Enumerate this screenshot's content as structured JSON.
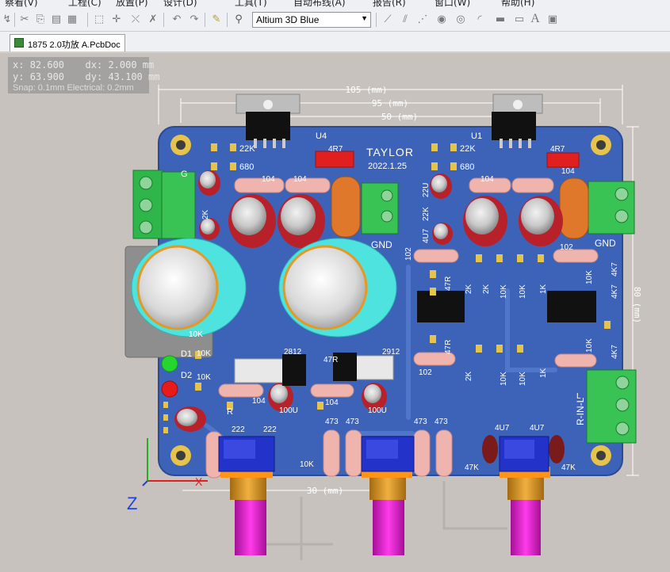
{
  "menu": {
    "items": [
      "察看(V)",
      "工程(C)",
      "放置(P)",
      "设计(D)",
      "工具(T)",
      "自动布线(A)",
      "报告(R)",
      "窗口(W)",
      "帮助(H)"
    ]
  },
  "toolbar": {
    "view_config": "Altium 3D Blue",
    "icons": [
      "cut-icon",
      "copy-icon",
      "paste-icon",
      "stamp-icon",
      "select-rect-icon",
      "move-icon",
      "deselect-icon",
      "clear-icon",
      "undo-icon",
      "redo-icon",
      "highlight-icon",
      "browse-icon",
      "route-icon",
      "net-icon",
      "bus-icon",
      "pad-icon",
      "via-icon",
      "arc-icon",
      "fill-icon",
      "text-icon",
      "component-icon"
    ]
  },
  "tabs": {
    "active_doc": "1875 2.0功放 A.PcbDoc"
  },
  "coords": {
    "x_label": "x:",
    "x": "82.600",
    "dx_label": "dx:",
    "dx": "2.000",
    "y_label": "y:",
    "y": "63.900",
    "dy_label": "dy:",
    "dy": "43.100",
    "unit": "mm",
    "snap": "Snap: 0.1mm Electrical: 0.2mm"
  },
  "pcb": {
    "dimensions": {
      "outer": "105 (mm)",
      "middle": "95 (mm)",
      "inner": "50 (mm)",
      "right": "80 (mm)",
      "bottom": "30 (mm)"
    },
    "silkscreen": {
      "brand": "TAYLOR",
      "date": "2022.1.25",
      "u4": "U4",
      "u1": "U1",
      "gnd_left": "GND",
      "gnd_right": "GND",
      "input": "R-IN-L",
      "d1": "D1",
      "d2": "D2",
      "z_axis": "Z"
    },
    "labels": [
      "22K",
      "680",
      "4R7",
      "104",
      "104",
      "22U",
      "22K",
      "4U7",
      "102",
      "47R",
      "2K",
      "2K",
      "10K",
      "10K",
      "1K",
      "10K",
      "4K7",
      "22K",
      "680",
      "4R7",
      "104",
      "104",
      "102",
      "4K7",
      "47R",
      "10K",
      "1K",
      "10K",
      "10K",
      "2K",
      "102",
      "4K7",
      "47R",
      "2812",
      "2912",
      "10K",
      "10K",
      "104",
      "100U",
      "100U",
      "104",
      "473",
      "473",
      "473",
      "473",
      "4U7",
      "4U7",
      "222",
      "222",
      "10K",
      "47K",
      "47K",
      "2K",
      "10K",
      "G",
      "R",
      "L"
    ],
    "colors": {
      "board": "#3d63b8",
      "pad": "#e6c34a",
      "cap_body": "#b8202a",
      "big_cap": "#4fe3e0",
      "terminal": "#2fb64a",
      "resistor": "#f0b4ae",
      "pot": "#2332c8",
      "shaft": "#e020c8"
    }
  }
}
